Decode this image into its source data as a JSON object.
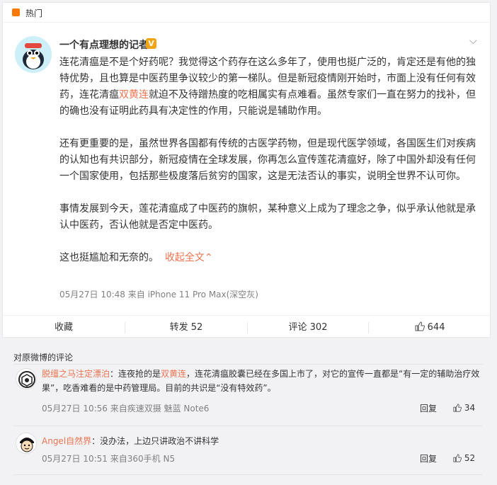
{
  "hot": {
    "label": "热门"
  },
  "post": {
    "user": "一个有点理想的记者",
    "verified_mark": "V",
    "paragraphs": [
      {
        "pre": "连花清瘟是不是个好药呢？我觉得这个药存在这么多年了，使用也挺广泛的，肯定还是有他的独特优势，且也算是中医药里争议较少的第一梯队。但是新冠疫情刚开始时，市面上没有任何有效药，连花清瘟",
        "hl": "双黄连",
        "post": "就迫不及待蹭热度的吃相属实有点难看。虽然专家们一直在努力的找补，但的确也没有证明此药具有决定性的作用，只能说是辅助作用。"
      },
      {
        "text": "还有更重要的是，虽然世界各国都有传统的古医学药物，但是现代医学领域，各国医生们对疾病的认知也有共识部分，新冠疫情在全球发展，你再怎么宣传莲花清瘟好，除了中国外却没有任何一个国家使用，包括那些极度落后贫穷的国家，这是无法否认的事实，说明全世界不认可你。"
      },
      {
        "text": "事情发展到今天，莲花清瘟成了中医药的旗帜，某种意义上成为了理念之争，似乎承认他就是承认中医药，否认他就是否定中医药。"
      },
      {
        "text": "这也挺尴尬和无奈的。",
        "link": "收起全文"
      }
    ],
    "collapse_arrow": "⌃",
    "meta": "05月27日 10:48  来自 iPhone 11 Pro Max(深空灰)"
  },
  "actions": {
    "favorite": "收藏",
    "repost": "转发 52",
    "comment": "评论 302",
    "like": "644"
  },
  "comments": {
    "title": "对原微博的评论",
    "items": [
      {
        "user": "脱缰之马注定漂泊",
        "pre": "：连夜抢的是",
        "hl": "双黄连",
        "post": "，连花清瘟胶囊已经在多国上市了，对它的宣传一直都是“有一定的辅助治疗效果”，吃香难看的是中药管理局。目前的共识是“没有特效药”。",
        "meta": "05月27日 10:56 来自疾速双摄 魅蓝 Note6",
        "reply": "回复",
        "likes": "34"
      },
      {
        "user": "Angel自然界",
        "pre": "：没办法，上边只讲政治不讲科学",
        "hl": "",
        "post": "",
        "meta": "05月27日 10:51 来自360手机 N5",
        "reply": "回复",
        "likes": "52"
      }
    ]
  }
}
